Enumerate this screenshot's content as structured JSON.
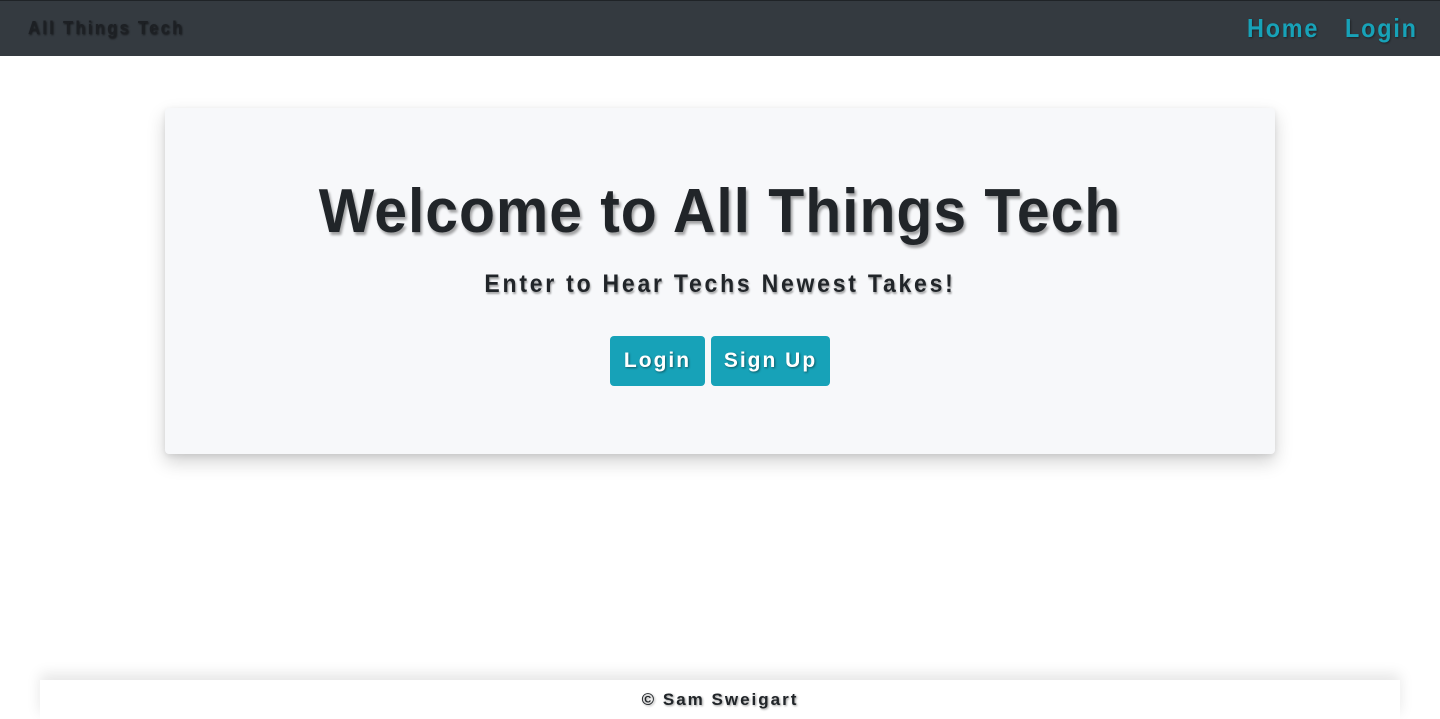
{
  "navbar": {
    "brand": "All Things Tech",
    "links": [
      {
        "label": "Home"
      },
      {
        "label": "Login"
      }
    ],
    "link_color": "#17a2b8",
    "background_color": "#343a40"
  },
  "hero": {
    "title": "Welcome to All Things Tech",
    "subtitle": "Enter to Hear Techs Newest Takes!",
    "buttons": {
      "login_label": "Login",
      "signup_label": "Sign Up"
    },
    "button_color": "#17a2b8"
  },
  "footer": {
    "text": "© Sam Sweigart"
  }
}
